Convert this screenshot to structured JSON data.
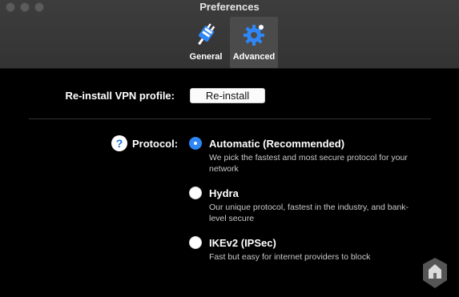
{
  "window": {
    "title": "Preferences"
  },
  "tabs": [
    {
      "label": "General",
      "icon": "vpn-plug-icon",
      "selected": false
    },
    {
      "label": "Advanced",
      "icon": "gear-icon",
      "selected": true
    }
  ],
  "reinstall": {
    "label": "Re-install VPN profile:",
    "button_label": "Re-install"
  },
  "protocol": {
    "label": "Protocol:",
    "help_glyph": "?",
    "options": [
      {
        "title": "Automatic (Recommended)",
        "description": "We pick the fastest and most secure protocol for your network",
        "selected": true
      },
      {
        "title": "Hydra",
        "description": "Our unique protocol, fastest in the industry, and bank-level secure",
        "selected": false
      },
      {
        "title": "IKEv2 (IPSec)",
        "description": "Fast but easy for internet providers to block",
        "selected": false
      }
    ]
  },
  "colors": {
    "accent": "#2f86f6",
    "background": "#000000",
    "toolbar": "#3a3a3a"
  }
}
